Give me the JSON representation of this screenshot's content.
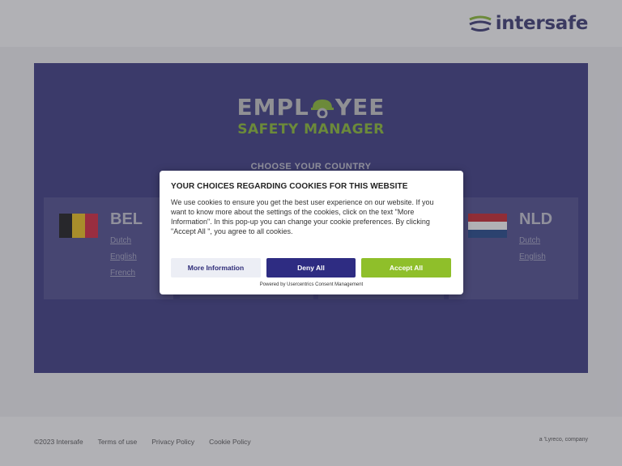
{
  "header": {
    "logo_text": "intersafe"
  },
  "hero": {
    "brand_line1_left": "EMPL",
    "brand_line1_right": "YEE",
    "brand_line2": "SAFETY MANAGER",
    "choose_label": "CHOOSE YOUR COUNTRY",
    "countries": [
      {
        "code": "BEL",
        "languages": [
          "Dutch",
          "English",
          "French"
        ],
        "flag_colors": [
          "#1a1a1a",
          "#f0c419",
          "#d7263d"
        ]
      },
      {
        "code": "NLD",
        "languages": [
          "Dutch",
          "English"
        ],
        "flag_colors": [
          "#c8232c",
          "#ffffff",
          "#21468b"
        ]
      }
    ]
  },
  "cookie_dialog": {
    "title": "YOUR CHOICES REGARDING COOKIES FOR THIS WEBSITE",
    "body": "We use cookies to ensure you get the best user experience on our website. If you want to know more about the settings of the cookies, click on the text \"More Information\". In this pop-up you can change your cookie preferences. By clicking \"Accept All \", you agree to all cookies.",
    "more_info_label": "More Information",
    "deny_label": "Deny All",
    "accept_label": "Accept All",
    "powered_by": "Powered by Usercentrics Consent Management"
  },
  "footer": {
    "copyright": "©2023 Intersafe",
    "terms": "Terms of use",
    "privacy": "Privacy Policy",
    "cookie": "Cookie Policy",
    "company_note": "a 'Lyreco, company"
  },
  "colors": {
    "brand_navy": "#3b3a82",
    "brand_green": "#8fbf2a",
    "deny_button": "#2e2c82"
  }
}
